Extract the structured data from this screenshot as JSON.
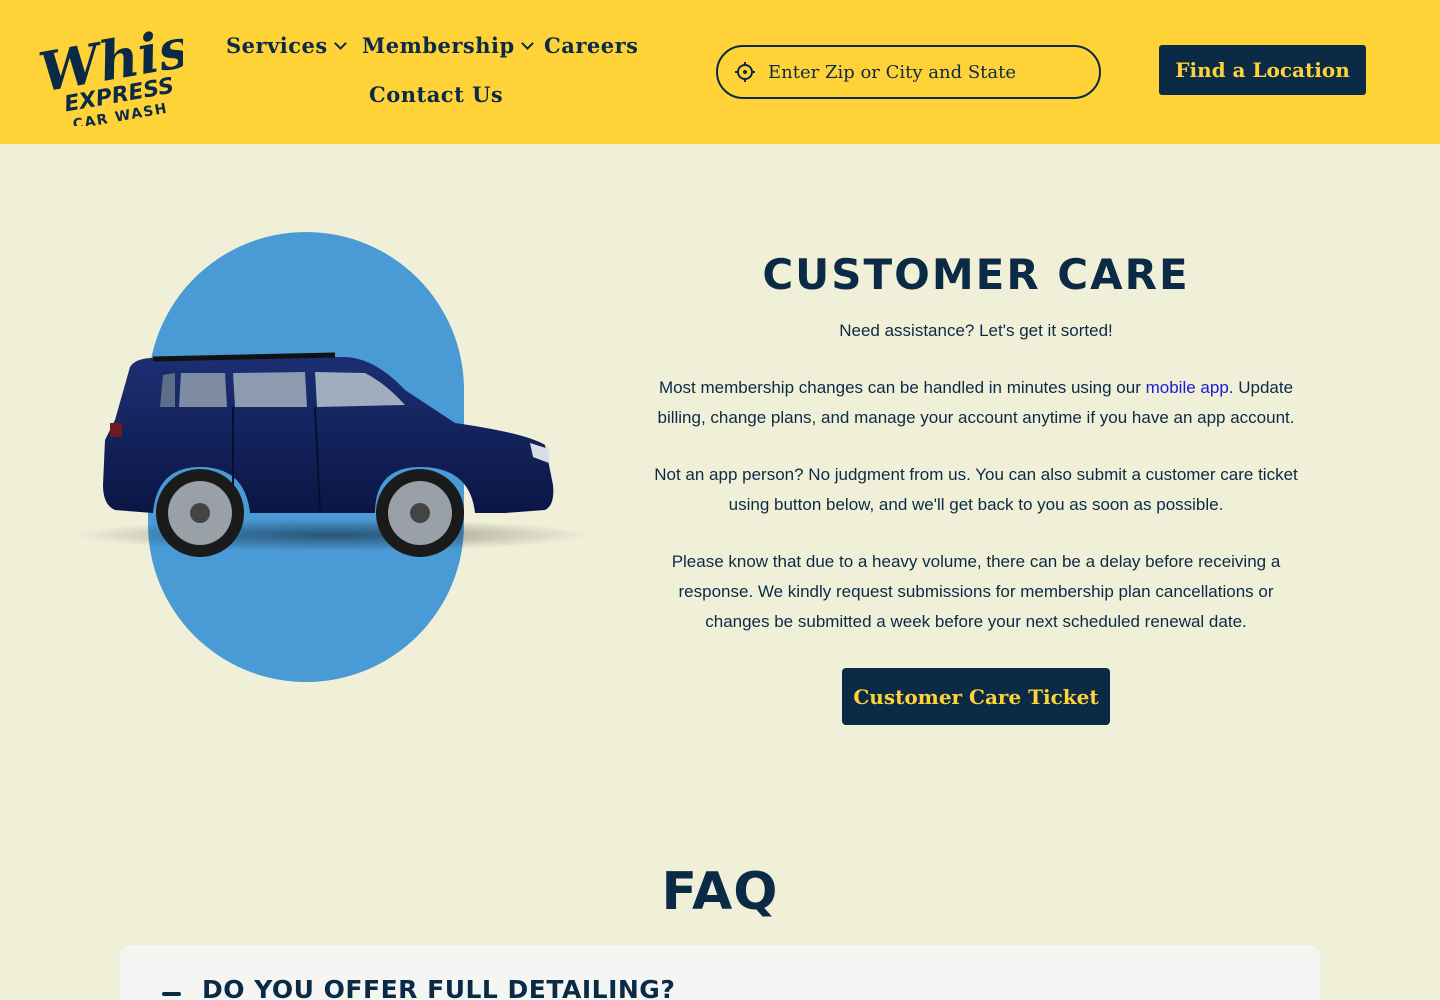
{
  "header": {
    "logo": {
      "icon": "whistle-express-car-wash-logo",
      "text_line1": "Whistle",
      "text_line2": "EXPRESS",
      "text_line3": "CAR WASH"
    },
    "nav": [
      {
        "label": "Services",
        "has_dropdown": true
      },
      {
        "label": "Membership",
        "has_dropdown": true
      },
      {
        "label": "Careers",
        "has_dropdown": false
      },
      {
        "label": "Contact Us",
        "has_dropdown": false
      }
    ],
    "search": {
      "placeholder": "Enter Zip or City and State",
      "value": "",
      "icon": "location-crosshair-icon"
    },
    "find_location_label": "Find a Location"
  },
  "customer_care": {
    "title": "CUSTOMER CARE",
    "subtitle": "Need assistance? Let's get it sorted!",
    "para_membership_prefix": "Most membership changes can be handled in minutes using our ",
    "para_membership_link": "mobile app",
    "para_membership_suffix": ". Update billing, change plans, and manage your account anytime if you have an app account.",
    "para_ticket": "Not an app person? No judgment from us. You can also submit a customer care ticket using button below, and we'll get back to you as soon as possible.",
    "para_delay": "Please know that due to a heavy volume, there can be a delay before receiving a response. We kindly request submissions for membership plan cancellations or changes be submitted a week before your next scheduled renewal date.",
    "button_label": "Customer Care Ticket",
    "image": "navy-suv-car-image"
  },
  "faq": {
    "title": "FAQ",
    "items": [
      {
        "question": "DO YOU OFFER FULL DETAILING?",
        "expanded": true
      }
    ]
  },
  "colors": {
    "header_bg": "#ffd338",
    "page_bg": "#f0f0d9",
    "navy": "#0b2a45",
    "blob_blue": "#4a9ad6",
    "link_blue": "#1a1ad8"
  }
}
